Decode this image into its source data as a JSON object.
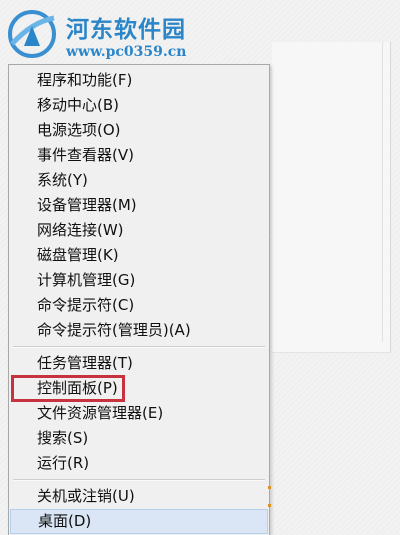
{
  "watermark": {
    "title": "河东软件园",
    "url": "www.pc0359.cn"
  },
  "menu": {
    "groups": [
      [
        {
          "label": "程序和功能(F)"
        },
        {
          "label": "移动中心(B)"
        },
        {
          "label": "电源选项(O)"
        },
        {
          "label": "事件查看器(V)"
        },
        {
          "label": "系统(Y)"
        },
        {
          "label": "设备管理器(M)"
        },
        {
          "label": "网络连接(W)"
        },
        {
          "label": "磁盘管理(K)"
        },
        {
          "label": "计算机管理(G)"
        },
        {
          "label": "命令提示符(C)"
        },
        {
          "label": "命令提示符(管理员)(A)"
        }
      ],
      [
        {
          "label": "任务管理器(T)"
        },
        {
          "label": "控制面板(P)"
        },
        {
          "label": "文件资源管理器(E)"
        },
        {
          "label": "搜索(S)"
        },
        {
          "label": "运行(R)"
        }
      ],
      [
        {
          "label": "关机或注销(U)"
        },
        {
          "label": "桌面(D)"
        }
      ]
    ],
    "hovered_item": "桌面(D)",
    "annotated_item": "控制面板(P)"
  },
  "colors": {
    "annotation_box": "#c8323e",
    "hover_background": "#dae6f5",
    "watermark_text": "#2a86c8"
  }
}
